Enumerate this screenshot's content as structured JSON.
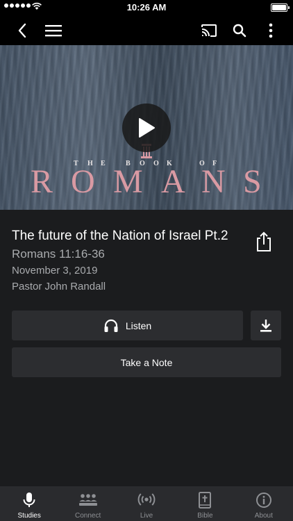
{
  "status_bar": {
    "time": "10:26 AM"
  },
  "hero": {
    "the": [
      "T",
      "H",
      "E"
    ],
    "book": [
      "B",
      "O",
      "O",
      "K"
    ],
    "of": [
      "O",
      "F"
    ],
    "romans": [
      "R",
      "O",
      "M",
      "A",
      "N",
      "S"
    ]
  },
  "sermon": {
    "title": "The future of the Nation of Israel Pt.2",
    "scripture": "Romans 11:16-36",
    "date": "November 3, 2019",
    "speaker": "Pastor John Randall"
  },
  "actions": {
    "listen_label": "Listen",
    "note_label": "Take a Note"
  },
  "tabs": [
    {
      "label": "Studies",
      "icon": "microphone-icon",
      "active": true
    },
    {
      "label": "Connect",
      "icon": "group-icon",
      "active": false
    },
    {
      "label": "Live",
      "icon": "broadcast-icon",
      "active": false
    },
    {
      "label": "Bible",
      "icon": "bible-icon",
      "active": false
    },
    {
      "label": "About",
      "icon": "info-icon",
      "active": false
    }
  ],
  "colors": {
    "background": "#1b1c1e",
    "button": "#2c2d30",
    "tabbar": "#2a2b2e",
    "secondary_text": "#a9abae",
    "accent_pink": "#d99aa3"
  }
}
